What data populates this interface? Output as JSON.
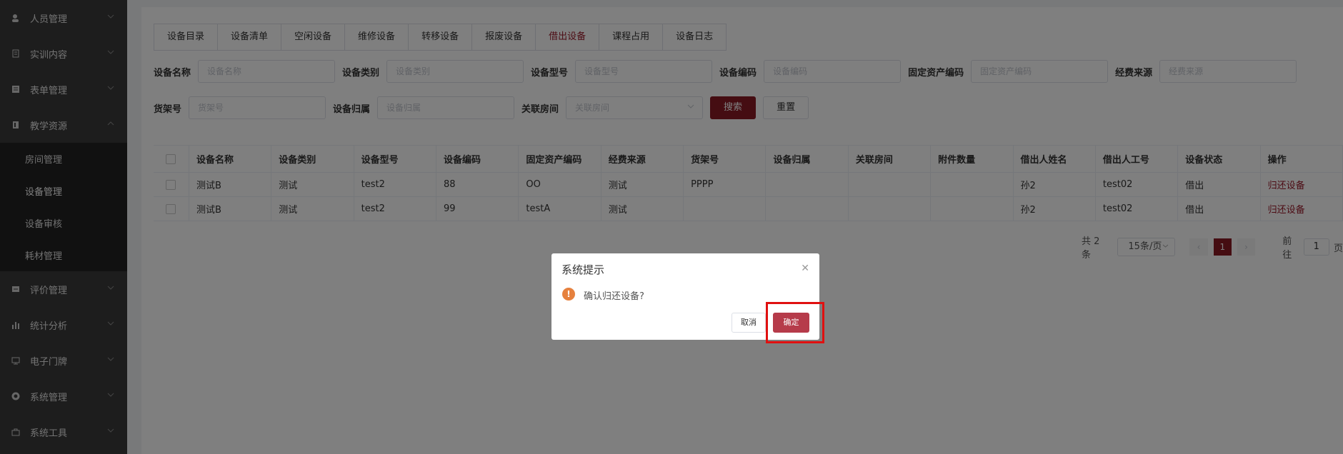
{
  "sidebar": {
    "items": [
      {
        "label": "人员管理",
        "icon": "user-icon"
      },
      {
        "label": "实训内容",
        "icon": "document-icon"
      },
      {
        "label": "表单管理",
        "icon": "form-icon"
      },
      {
        "label": "教学资源",
        "icon": "book-icon"
      },
      {
        "label": "评价管理",
        "icon": "rating-icon"
      },
      {
        "label": "统计分析",
        "icon": "bar-chart-icon"
      },
      {
        "label": "电子门牌",
        "icon": "monitor-icon"
      },
      {
        "label": "系统管理",
        "icon": "gear-icon"
      },
      {
        "label": "系统工具",
        "icon": "toolbox-icon"
      }
    ],
    "submenu": [
      {
        "label": "房间管理"
      },
      {
        "label": "设备管理"
      },
      {
        "label": "设备审核"
      },
      {
        "label": "耗材管理"
      }
    ]
  },
  "tabs": [
    {
      "label": "设备目录"
    },
    {
      "label": "设备清单"
    },
    {
      "label": "空闲设备"
    },
    {
      "label": "维修设备"
    },
    {
      "label": "转移设备"
    },
    {
      "label": "报废设备"
    },
    {
      "label": "借出设备"
    },
    {
      "label": "课程占用"
    },
    {
      "label": "设备日志"
    }
  ],
  "filters": {
    "name": {
      "label": "设备名称",
      "placeholder": "设备名称"
    },
    "category": {
      "label": "设备类别",
      "placeholder": "设备类别"
    },
    "model": {
      "label": "设备型号",
      "placeholder": "设备型号"
    },
    "code": {
      "label": "设备编码",
      "placeholder": "设备编码"
    },
    "asset": {
      "label": "固定资产编码",
      "placeholder": "固定资产编码"
    },
    "fund": {
      "label": "经费来源",
      "placeholder": "经费来源"
    },
    "shelf": {
      "label": "货架号",
      "placeholder": "货架号"
    },
    "owner": {
      "label": "设备归属",
      "placeholder": "设备归属"
    },
    "room": {
      "label": "关联房间",
      "placeholder": "关联房间"
    },
    "search_label": "搜索",
    "reset_label": "重置"
  },
  "table": {
    "headers": [
      "设备名称",
      "设备类别",
      "设备型号",
      "设备编码",
      "固定资产编码",
      "经费来源",
      "货架号",
      "设备归属",
      "关联房间",
      "附件数量",
      "借出人姓名",
      "借出人工号",
      "设备状态",
      "操作"
    ],
    "rows": [
      [
        "测试B",
        "测试",
        "test2",
        "88",
        "OO",
        "测试",
        "PPPP",
        "",
        "",
        "",
        "孙2",
        "test02",
        "借出",
        "归还设备"
      ],
      [
        "测试B",
        "测试",
        "test2",
        "99",
        "testA",
        "测试",
        "",
        "",
        "",
        "",
        "孙2",
        "test02",
        "借出",
        "归还设备"
      ]
    ]
  },
  "pagination": {
    "total": "共 2 条",
    "page_size": "15条/页",
    "current": "1",
    "goto_label": "前往",
    "goto_value": "1",
    "page_suffix": "页"
  },
  "dialog": {
    "title": "系统提示",
    "message": "确认归还设备?",
    "cancel_label": "取消",
    "confirm_label": "确定"
  },
  "colors": {
    "brand": "#8a1a25",
    "sidebar": "#3a3a3a",
    "warning": "#e6813e",
    "highlight": "#e01010"
  }
}
